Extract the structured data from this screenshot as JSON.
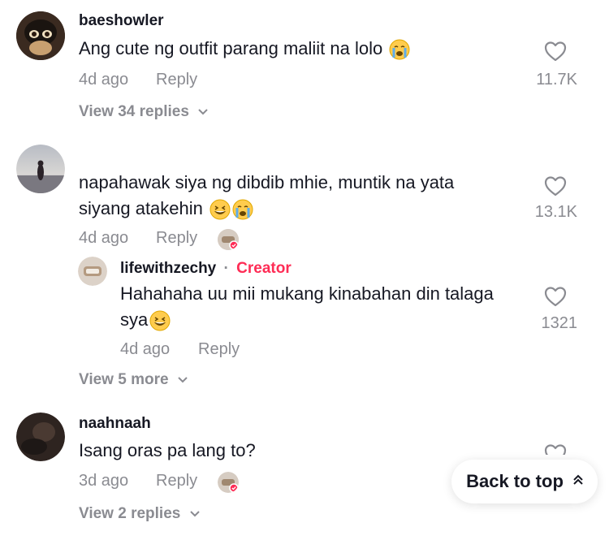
{
  "comments": [
    {
      "username": "baeshowler",
      "text": "Ang cute ng outfit parang maliit na lolo",
      "age": "4d ago",
      "reply": "Reply",
      "likes": "11.7K",
      "view_replies": "View 34 replies"
    },
    {
      "username": "",
      "text_line1": "napahawak siya ng dibdib mhie, muntik na yata",
      "text_line2": "siyang atakehin",
      "age": "4d ago",
      "reply": "Reply",
      "likes": "13.1K"
    },
    {
      "username": "naahnaah",
      "text": "Isang oras pa lang to?",
      "age": "3d ago",
      "reply": "Reply",
      "view_replies": "View 2 replies"
    }
  ],
  "creator_reply": {
    "username": "lifewithzechy",
    "separator": "·",
    "badge": "Creator",
    "text_line1": "Hahahaha uu mii mukang kinabahan din talaga",
    "text_line2": "sya",
    "age": "4d ago",
    "reply": "Reply",
    "likes": "1321"
  },
  "view_more": "View 5 more",
  "back_to_top": "Back to top",
  "colors": {
    "accent": "#fe2c55",
    "muted": "#8a8b91",
    "text": "#161823"
  }
}
